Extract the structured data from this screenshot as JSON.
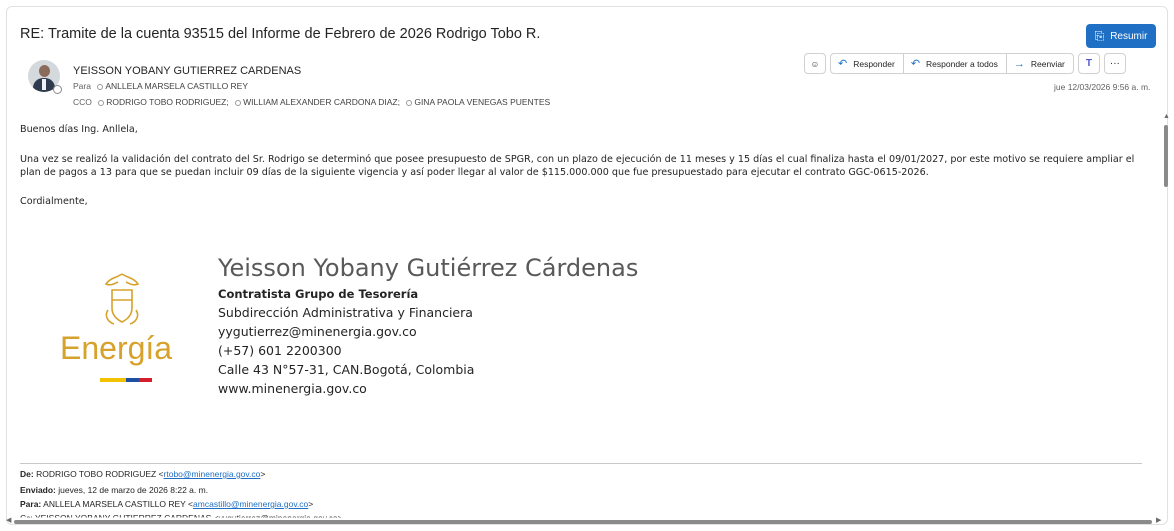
{
  "message": {
    "subject": "RE: Tramite de la cuenta 93515 del Informe de Febrero de 2026 Rodrigo Tobo R.",
    "summarize_label": "Resumir",
    "sender": "YEISSON YOBANY GUTIERREZ CARDENAS",
    "to_label": "Para",
    "to": "ANLLELA MARSELA CASTILLO REY",
    "cc_label": "CCO",
    "cc": [
      "RODRIGO TOBO RODRIGUEZ;",
      "WILLIAM ALEXANDER CARDONA DIAZ;",
      "GINA PAOLA VENEGAS PUENTES"
    ],
    "date": "jue 12/03/2026 9:56 a. m."
  },
  "actions": {
    "reply": "Responder",
    "reply_all": "Responder a todos",
    "forward": "Reenviar",
    "more": "···"
  },
  "body": {
    "greeting": "Buenos días Ing. Anllela,",
    "paragraph": "Una vez se realizó la validación del contrato del Sr. Rodrigo se determinó que posee presupuesto de SPGR, con un plazo de ejecución de 11 meses y 15 días el cual finaliza hasta el 09/01/2027, por este motivo se requiere ampliar el plan de pagos a 13 para que se puedan incluir 09 días de la siguiente vigencia y así poder llegar al valor de $115.000.000 que fue presupuestado para ejecutar el contrato GGC-0615-2026.",
    "closing": "Cordialmente,"
  },
  "signature": {
    "logo_text": "Energía",
    "name": "Yeisson Yobany Gutiérrez Cárdenas",
    "role": "Contratista Grupo de Tesorería",
    "department": "Subdirección Administrativa y Financiera",
    "email": "yygutierrez@minenergia.gov.co",
    "phone": "(+57) 601 2200300",
    "address": "Calle 43 N°57-31, CAN.Bogotá, Colombia",
    "website": "www.minenergia.gov.co"
  },
  "forwarded": {
    "from_label": "De:",
    "from_name": "RODRIGO TOBO RODRIGUEZ <",
    "from_email": "rtobo@minenergia.gov.co",
    "sent_label": "Enviado:",
    "sent": "jueves, 12 de marzo de 2026 8:22 a. m.",
    "to_label": "Para:",
    "to_name": "ANLLELA MARSELA CASTILLO REY <",
    "to_email": "amcastillo@minenergia.gov.co",
    "cc_partial": "Cc: YEISSON YOBANY GUTIERREZ CARDENAS <yygutierrez@minenergia.gov.co>"
  },
  "colors": {
    "accent": "#1f6fc4",
    "logo_gold": "#d7a22b",
    "flag": [
      "#f2c200",
      "#1f4fa0",
      "#d21f2b"
    ]
  }
}
